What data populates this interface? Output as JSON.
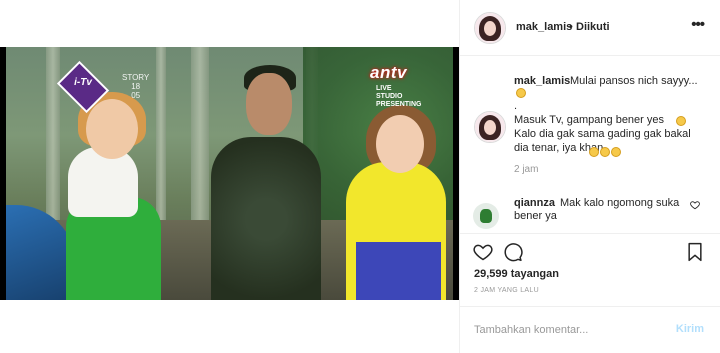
{
  "header": {
    "username": "mak_lamis",
    "separator": "•",
    "follow_status": "Diikuti",
    "more_label": "•••"
  },
  "video": {
    "channel_logo_text": "i-Tv",
    "channel_date": "STORY\n18\n05",
    "network": "antv",
    "network_sub": "LIVE\nSTUDIO\nPRESENTING"
  },
  "caption": {
    "username": "mak_lamis",
    "lines": [
      "Mulai pansos nich sayyy...",
      ".",
      "Masuk Tv, gampang bener yes",
      "Kalo dia gak sama gading gak bakal",
      "dia tenar, iya khan"
    ],
    "time": "2 jam"
  },
  "comments": [
    {
      "username": "qiannza",
      "text": "Mak kalo ngomong suka bener ya"
    }
  ],
  "stats": {
    "views": "29,599 tayangan",
    "posted": "2 JAM YANG LALU"
  },
  "add_comment": {
    "placeholder": "Tambahkan komentar...",
    "post_label": "Kirim"
  },
  "icons": [
    "heart-icon",
    "comment-icon",
    "bookmark-icon",
    "more-icon",
    "like-comment-icon"
  ],
  "colors": {
    "post_button": "#b2dffc",
    "secondary_text": "#999999",
    "network_accent": "#d21a1a"
  }
}
